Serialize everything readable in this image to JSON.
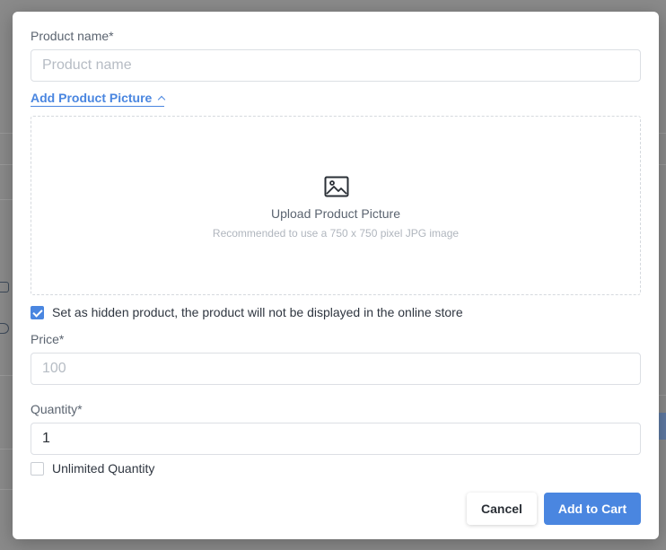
{
  "form": {
    "product_name_label": "Product name*",
    "product_name_placeholder": "Product name",
    "product_name_value": "",
    "add_picture_label": "Add Product Picture",
    "upload_title": "Upload Product Picture",
    "upload_hint": "Recommended to use a 750 x 750 pixel JPG image",
    "hidden_product_label": "Set as hidden product, the product will not be displayed in the online store",
    "hidden_product_checked": true,
    "price_label": "Price*",
    "price_placeholder": "100",
    "price_value": "",
    "quantity_label": "Quantity*",
    "quantity_value": "1",
    "unlimited_quantity_label": "Unlimited Quantity",
    "unlimited_quantity_checked": false
  },
  "actions": {
    "cancel_label": "Cancel",
    "primary_label": "Add to Cart"
  },
  "icons": {
    "picture": "image-icon",
    "toggle": "chevron-up-icon"
  },
  "colors": {
    "accent": "#4a86e0",
    "label": "#5b6470",
    "placeholder": "#b6bcc4"
  }
}
